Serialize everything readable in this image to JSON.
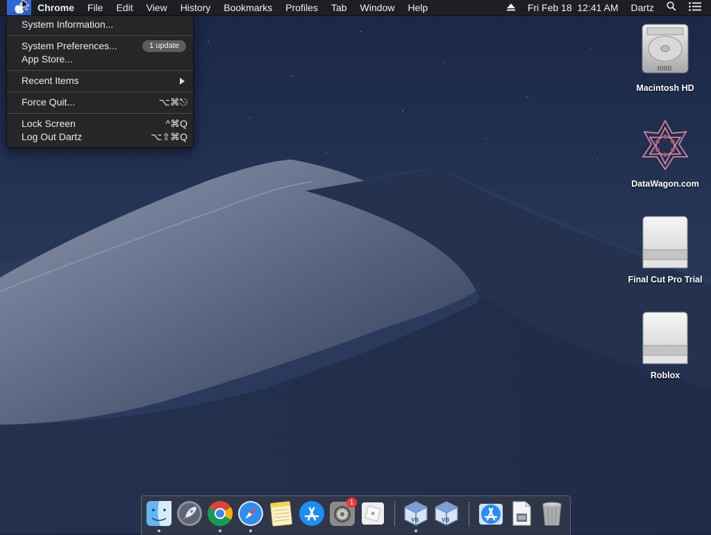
{
  "menubar": {
    "app_name": "Chrome",
    "menus": [
      "File",
      "Edit",
      "View",
      "History",
      "Bookmarks",
      "Profiles",
      "Tab",
      "Window",
      "Help"
    ],
    "status": {
      "datetime": "Fri Feb 18  12:41 AM",
      "user": "Dartz"
    }
  },
  "apple_menu": {
    "system_information": "System Information...",
    "system_preferences": "System Preferences...",
    "update_badge": "1 update",
    "app_store": "App Store...",
    "recent_items": "Recent Items",
    "force_quit": "Force Quit...",
    "force_quit_shortcut": "⌥⌘⎋",
    "lock_screen": "Lock Screen",
    "lock_screen_shortcut": "^⌘Q",
    "log_out": "Log Out Dartz",
    "log_out_shortcut": "⌥⇧⌘Q"
  },
  "desktop": {
    "icons": [
      {
        "label": "Macintosh HD",
        "icon": "hard-drive-icon"
      },
      {
        "label": "DataWagon.com",
        "icon": "datawagon-icon"
      },
      {
        "label": "Final Cut Pro Trial",
        "icon": "disk-image-icon"
      },
      {
        "label": "Roblox",
        "icon": "disk-image-icon"
      }
    ]
  },
  "dock": {
    "items": [
      "Finder",
      "Launchpad",
      "Google Chrome",
      "Safari",
      "Notes",
      "App Store",
      "System Preferences",
      "Roblox",
      "VirtualBox",
      "VirtualBox",
      "Applications",
      "Documents",
      "Trash"
    ],
    "system_preferences_badge": "1"
  },
  "colors": {
    "menu_highlight": "#2f6ad8",
    "badge_red": "#ec3a35",
    "wallpaper_sky": "#1b2744"
  }
}
